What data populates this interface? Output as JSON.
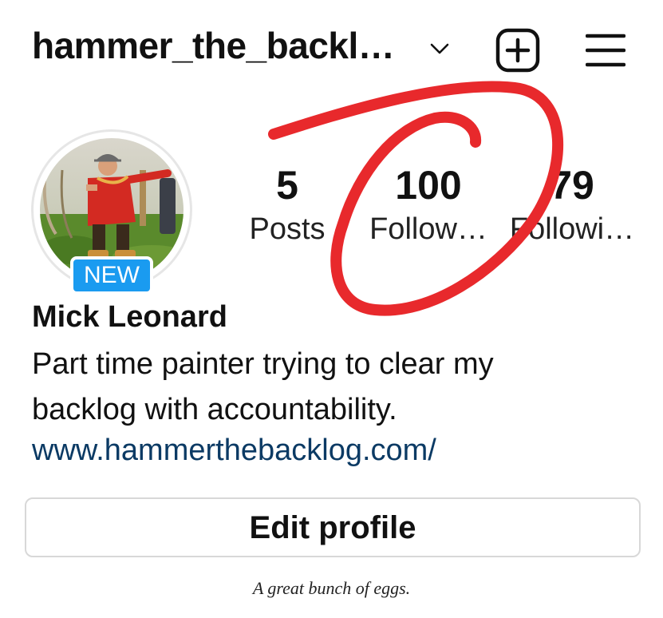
{
  "header": {
    "username": "hammer_the_backl…",
    "icons": [
      "chevron-down-icon",
      "add-post-icon",
      "menu-icon"
    ]
  },
  "profile": {
    "badge": "NEW",
    "name": "Mick Leonard",
    "bio": "Part time painter trying to clear my backlog with accountability.",
    "link": "www.hammerthebacklog.com/"
  },
  "stats": {
    "posts": {
      "value": "5",
      "label": "Posts"
    },
    "followers": {
      "value": "100",
      "label": "Follow…"
    },
    "following": {
      "value": "79",
      "label": "Followi…"
    }
  },
  "actions": {
    "edit_profile": "Edit profile"
  },
  "caption": "A great bunch of eggs.",
  "colors": {
    "badge": "#1a9bf0",
    "link": "#0b3a64",
    "annotation": "#e8292c"
  }
}
